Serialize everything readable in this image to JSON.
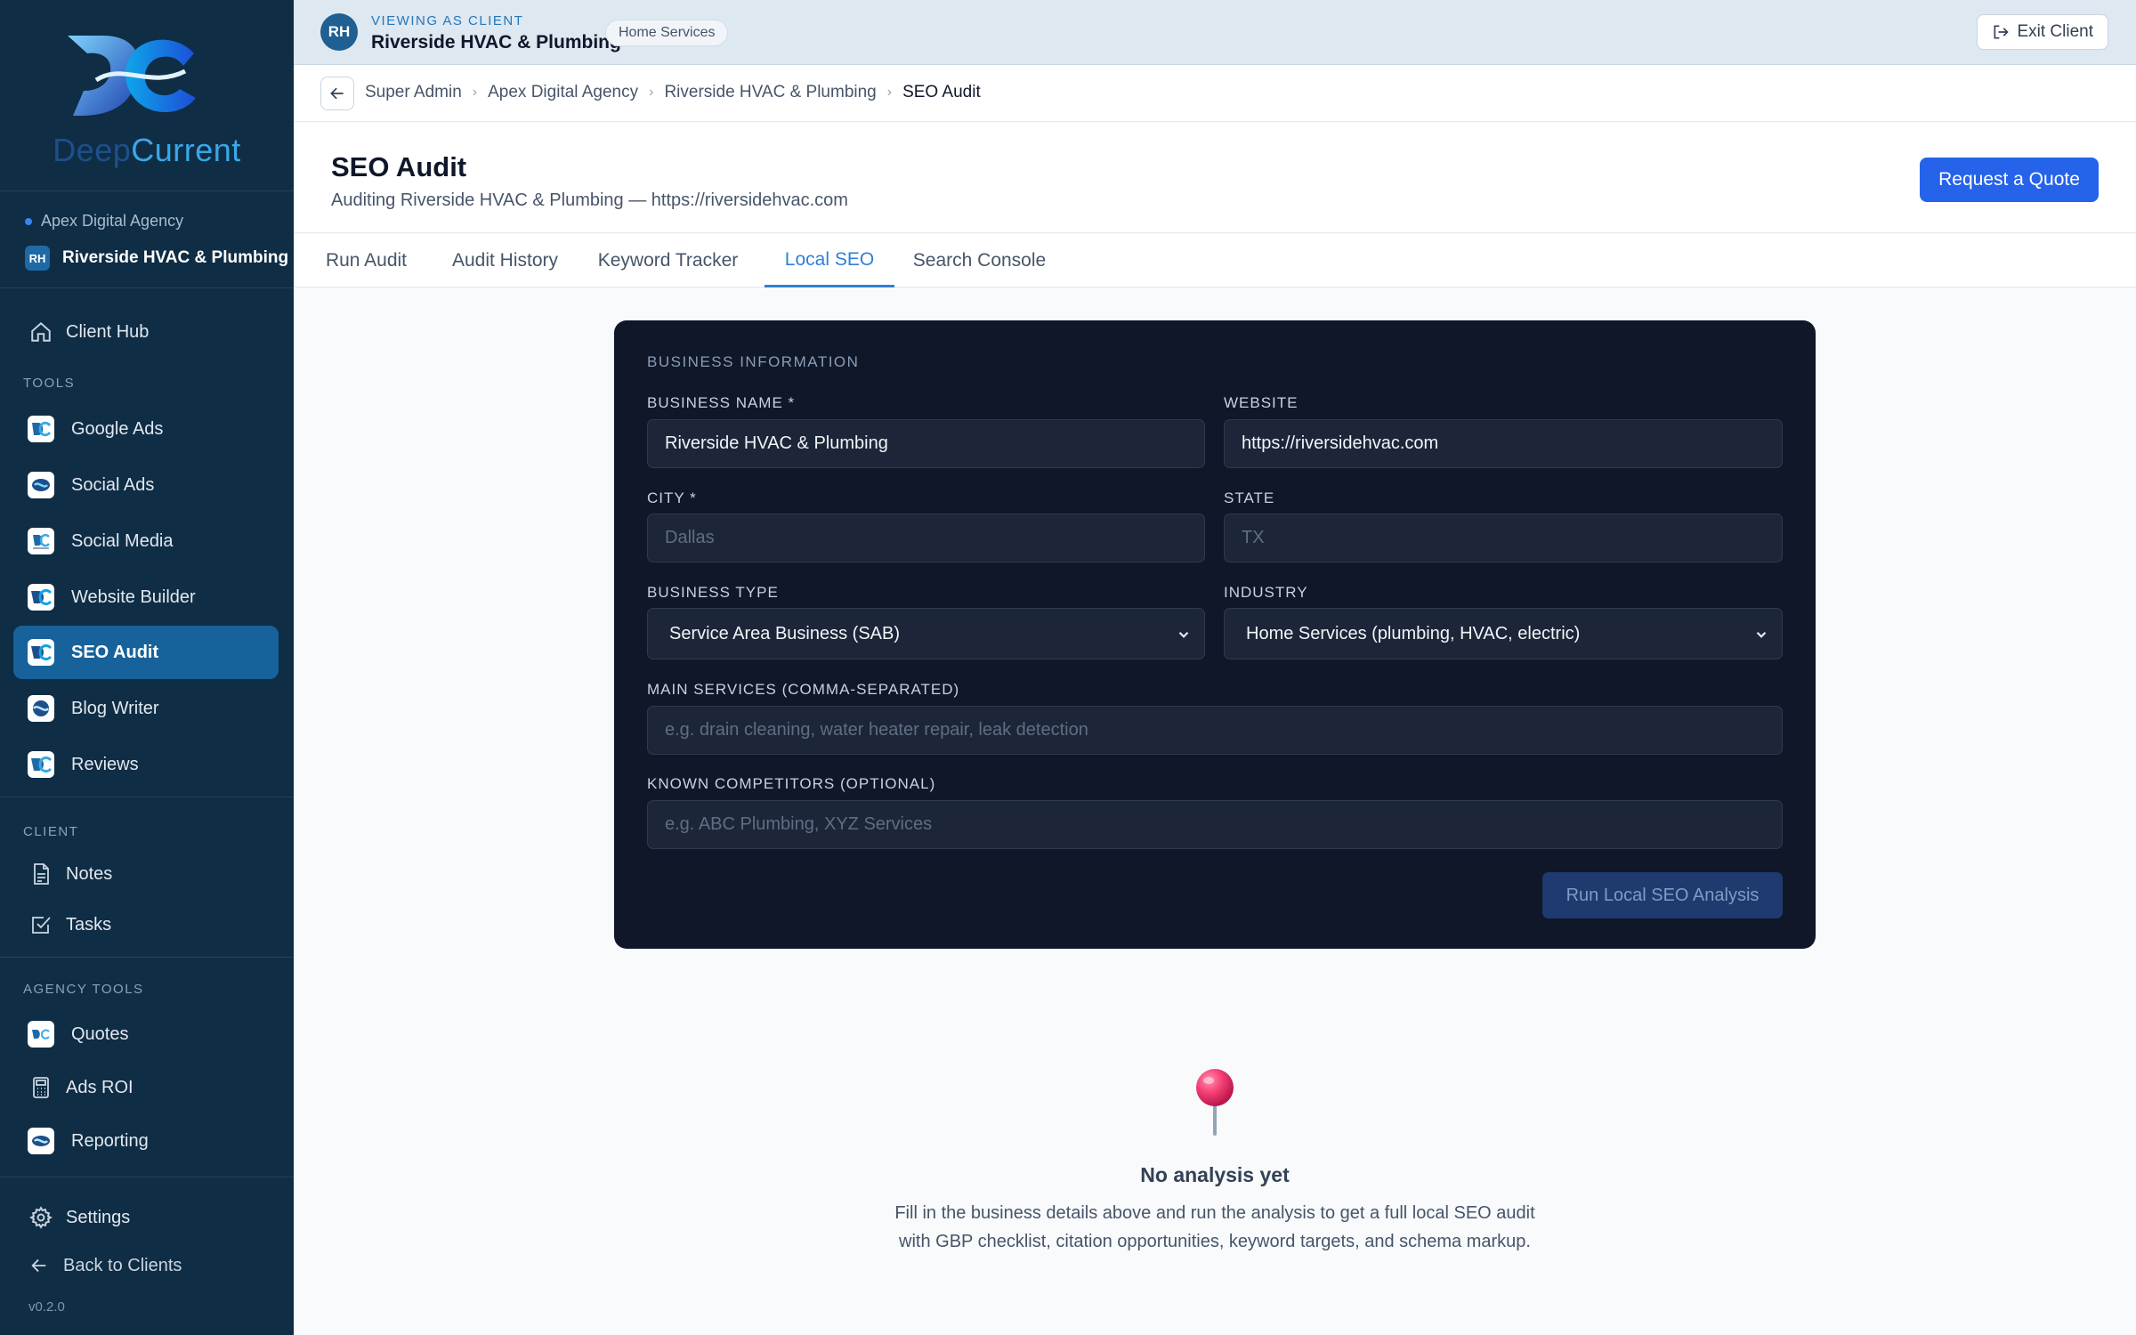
{
  "brand": {
    "name_part1": "Deep",
    "name_part2": "Current"
  },
  "sidebar": {
    "agency": "Apex Digital Agency",
    "client_initials": "RH",
    "client_name": "Riverside HVAC & Plumbing",
    "client_hub": "Client Hub",
    "tools_heading": "TOOLS",
    "tools": [
      {
        "label": "Google Ads",
        "icon": "dc-logo-icon"
      },
      {
        "label": "Social Ads",
        "icon": "social-ads-icon"
      },
      {
        "label": "Social Media",
        "icon": "social-media-icon"
      },
      {
        "label": "Website Builder",
        "icon": "website-builder-icon"
      },
      {
        "label": "SEO Audit",
        "icon": "seo-audit-icon",
        "active": true
      },
      {
        "label": "Blog Writer",
        "icon": "blog-writer-icon"
      },
      {
        "label": "Reviews",
        "icon": "reviews-icon"
      }
    ],
    "client_heading": "CLIENT",
    "client_items": [
      {
        "label": "Notes",
        "icon": "document-icon"
      },
      {
        "label": "Tasks",
        "icon": "checkbox-icon"
      }
    ],
    "agency_heading": "AGENCY TOOLS",
    "agency_items": [
      {
        "label": "Quotes",
        "icon": "quotes-icon"
      },
      {
        "label": "Ads ROI",
        "icon": "calculator-icon"
      },
      {
        "label": "Reporting",
        "icon": "reporting-icon"
      }
    ],
    "settings": "Settings",
    "back_to_clients": "Back to Clients",
    "version": "v0.2.0"
  },
  "banner": {
    "initials": "RH",
    "viewing_label": "VIEWING AS CLIENT",
    "client_name": "Riverside HVAC & Plumbing",
    "industry_chip": "Home Services",
    "exit_label": "Exit Client"
  },
  "breadcrumb": {
    "items": [
      "Super Admin",
      "Apex Digital Agency",
      "Riverside HVAC & Plumbing",
      "SEO Audit"
    ]
  },
  "header": {
    "title": "SEO Audit",
    "subtitle": "Auditing Riverside HVAC & Plumbing — https://riversidehvac.com",
    "quote_button": "Request a Quote"
  },
  "tabs": [
    {
      "label": "Run Audit"
    },
    {
      "label": "Audit History"
    },
    {
      "label": "Keyword Tracker"
    },
    {
      "label": "Local SEO",
      "active": true
    },
    {
      "label": "Search Console"
    }
  ],
  "form": {
    "section_title": "BUSINESS INFORMATION",
    "business_name": {
      "label": "BUSINESS NAME *",
      "value": "Riverside HVAC & Plumbing"
    },
    "website": {
      "label": "WEBSITE",
      "value": "https://riversidehvac.com"
    },
    "city": {
      "label": "CITY *",
      "value": "",
      "placeholder": "Dallas"
    },
    "state": {
      "label": "STATE",
      "value": "",
      "placeholder": "TX"
    },
    "business_type": {
      "label": "BUSINESS TYPE",
      "value": "Service Area Business (SAB)"
    },
    "industry": {
      "label": "INDUSTRY",
      "value": "Home Services (plumbing, HVAC, electric)"
    },
    "services": {
      "label": "MAIN SERVICES (COMMA-SEPARATED)",
      "value": "",
      "placeholder": "e.g. drain cleaning, water heater repair, leak detection"
    },
    "competitors": {
      "label": "KNOWN COMPETITORS (OPTIONAL)",
      "value": "",
      "placeholder": "e.g. ABC Plumbing, XYZ Services"
    },
    "run_button": "Run Local SEO Analysis"
  },
  "empty_state": {
    "icon": "pushpin-icon",
    "title": "No analysis yet",
    "description": "Fill in the business details above and run the analysis to get a full local SEO audit with GBP checklist, citation opportunities, keyword targets, and schema markup."
  },
  "colors": {
    "sidebar_bg": "#0f2d44",
    "active_nav": "#17629a",
    "accent": "#2563eb",
    "card_bg": "#0f1729",
    "tab_active": "#2f7fd8"
  }
}
